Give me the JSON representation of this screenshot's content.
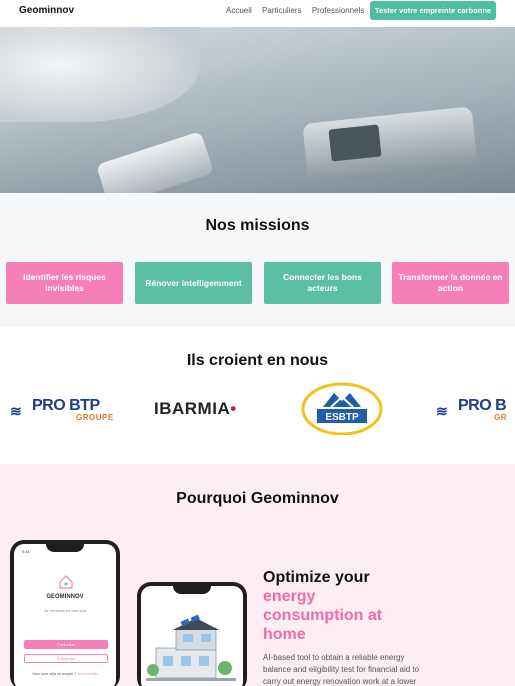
{
  "nav": {
    "brand": "Geominnov",
    "links": [
      "Accueil",
      "Particuliers",
      "Professionnels"
    ],
    "cta": "Tester votre empreinte carbonne"
  },
  "missions": {
    "title": "Nos missions",
    "buttons": [
      {
        "label": "Identifier les risques invisibles",
        "color": "#f57fb6"
      },
      {
        "label": "Rénover intelligemment",
        "color": "#5bbfa2"
      },
      {
        "label": "Connecter les bons acteurs",
        "color": "#5bbfa2"
      },
      {
        "label": "Transformer la donnée en action",
        "color": "#f57fb6"
      }
    ]
  },
  "partners": {
    "title": "Ils croient en nous",
    "logos": [
      {
        "name": "PRO BTP",
        "sub": "GROUPE"
      },
      {
        "name": "IBARMIA"
      },
      {
        "name": "ESBTP"
      },
      {
        "name": "PRO B",
        "sub": "GR"
      }
    ]
  },
  "why": {
    "title": "Pourquoi Geominnov",
    "heading_black": "Optimize your",
    "heading_pink": "energy consumption at home",
    "body": "AI-based tool to obtain a reliable energy balance and eligibility test for financial aid to carry out energy renovation work at a lower",
    "phone1": {
      "time": "9:41",
      "brand": "GEOMINNOV",
      "tagline": "Je m'inscris en tant que",
      "btn1": "Particulier",
      "btn2": "Entreprise",
      "footer_prefix": "Vous avez déjà un compte ?",
      "footer_link": "Se connecter"
    }
  },
  "colors": {
    "teal": "#4fbda0",
    "pink": "#f57fb6",
    "pink_text": "#f06aa9",
    "navy": "#1f3c88"
  }
}
